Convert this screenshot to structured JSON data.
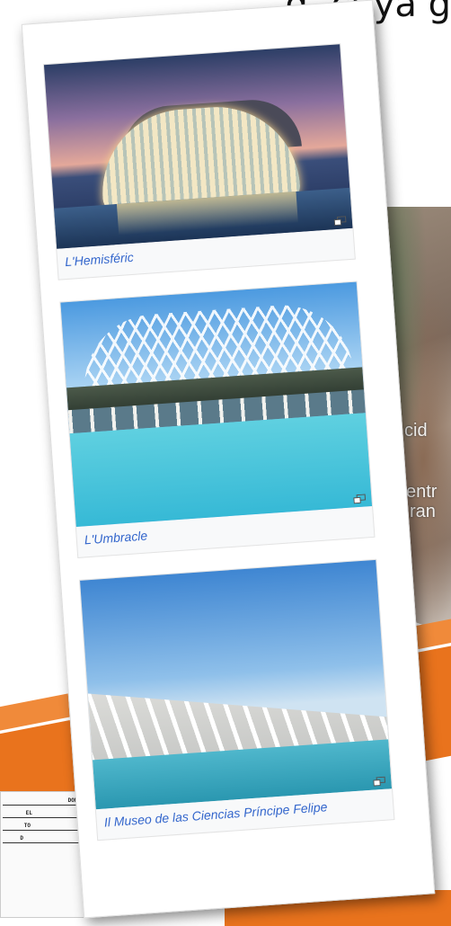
{
  "header": {
    "partial_text": "d, cuya g"
  },
  "map": {
    "label_1": "cid",
    "label_2": "entr",
    "label_3": "ran"
  },
  "gallery": {
    "items": [
      {
        "caption": "L'Hemisféric"
      },
      {
        "caption": "L'Umbracle"
      },
      {
        "caption": "Il Museo de las Ciencias Príncipe Felipe"
      }
    ]
  },
  "document_thumb": {
    "lines": [
      "DOME",
      "EL",
      "TO",
      "D"
    ]
  },
  "colors": {
    "accent_orange": "#e9731d",
    "link_blue": "#3366cc"
  }
}
